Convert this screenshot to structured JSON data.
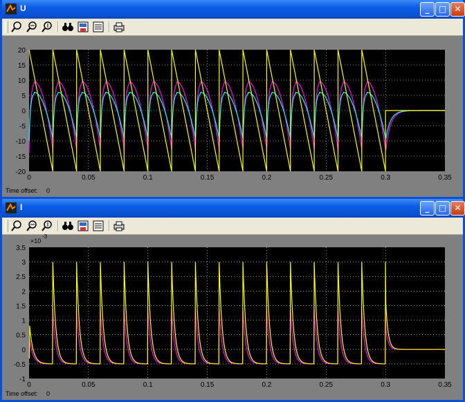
{
  "windows": [
    {
      "title": "U",
      "time_offset_label": "Time offset:",
      "time_offset_value": "0",
      "chart_data": {
        "type": "line",
        "xlim": [
          0,
          0.35
        ],
        "ylim": [
          -20,
          20
        ],
        "x_ticks": [
          "0",
          "0.05",
          "0.1",
          "0.15",
          "0.2",
          "0.25",
          "0.3",
          "0.35"
        ],
        "y_ticks": [
          "20",
          "15",
          "10",
          "5",
          "0",
          "-5",
          "-10",
          "-15",
          "-20"
        ],
        "y_exponent": "",
        "grid": true,
        "background": "#000000",
        "series": [
          {
            "color": "#ffff00",
            "description": "sawtooth ±20, period 0.02, active until 0.3"
          },
          {
            "color": "#ff00ff",
            "description": "peaks ~9, troughs ~-14, decays to 0 after 0.3"
          },
          {
            "color": "#00ffff",
            "description": "peaks ~6, troughs ~-10, decays to 0 after 0.3"
          }
        ]
      }
    },
    {
      "title": "I",
      "time_offset_label": "Time offset:",
      "time_offset_value": "0",
      "chart_data": {
        "type": "line",
        "xlim": [
          0,
          0.35
        ],
        "ylim": [
          -1,
          3.5
        ],
        "x_ticks": [
          "0",
          "0.05",
          "0.1",
          "0.15",
          "0.2",
          "0.25",
          "0.3",
          "0.35"
        ],
        "y_ticks": [
          "3.5",
          "3",
          "2.5",
          "2",
          "1.5",
          "1",
          "0.5",
          "0",
          "-0.5",
          "-1"
        ],
        "y_exponent": "-3",
        "grid": true,
        "background": "#000000",
        "series": [
          {
            "color": "#ffff00",
            "description": "spikes ~3.0e-3 every 0.02 s, decay to -0.5e-3, settles to 0 after 0.3"
          },
          {
            "color": "#ff00ff",
            "description": "spikes ~1.4e-3 every 0.02 s, decay to -0.5e-3, settles to 0 after 0.3"
          }
        ]
      }
    }
  ],
  "toolbar_icons": [
    "zoom-icon",
    "zoom-x-icon",
    "zoom-y-icon",
    "binoculars-icon",
    "save-axes-icon",
    "parameters-icon",
    "print-icon"
  ]
}
